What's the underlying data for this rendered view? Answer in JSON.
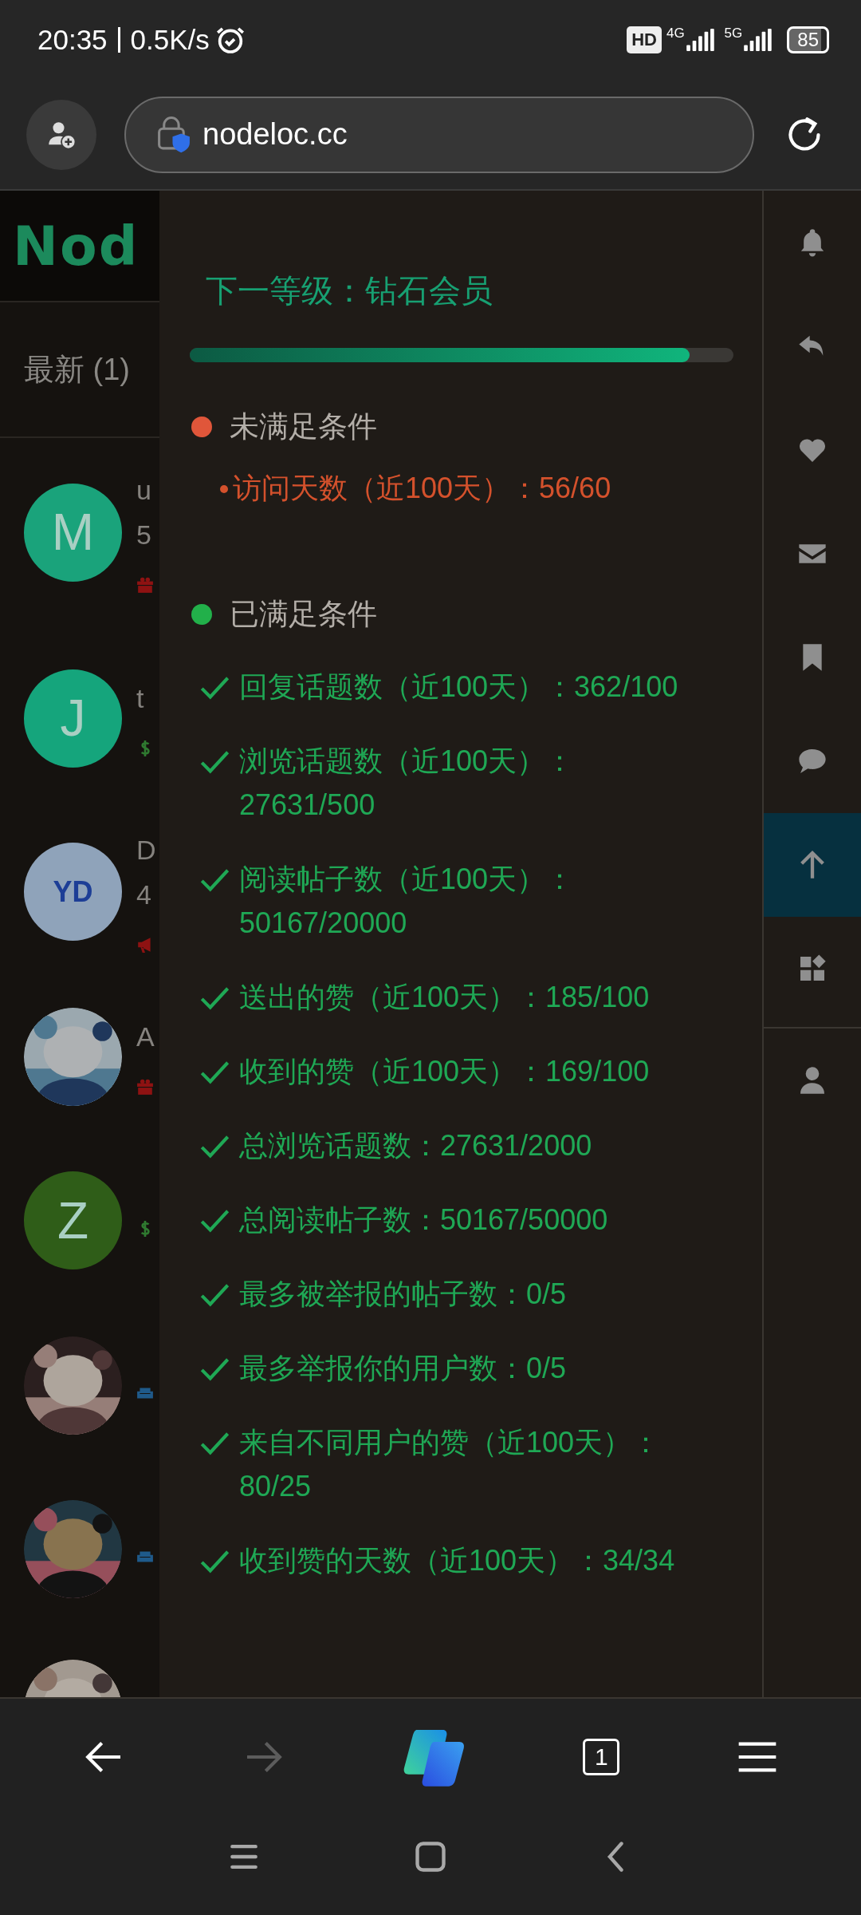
{
  "status_bar": {
    "time": "20:35",
    "speed": "0.5K/s",
    "hd": "HD",
    "network_1": "4G",
    "network_2": "5G",
    "battery": "85"
  },
  "address_bar": {
    "url": "nodeloc.cc"
  },
  "background_page": {
    "logo": "Nod",
    "tab": "最新 (1)",
    "topics": [
      {
        "avatar": {
          "kind": "letter",
          "text": "M",
          "color": "#1aa37b"
        },
        "lines": [
          "u",
          "5"
        ],
        "tag": {
          "kind": "gift"
        }
      },
      {
        "avatar": {
          "kind": "letter",
          "text": "J",
          "color": "#15a57c"
        },
        "lines": [
          "t"
        ],
        "tag": {
          "kind": "dollar"
        }
      },
      {
        "avatar": {
          "kind": "letter",
          "text": "YD",
          "color": "#8fa3ba"
        },
        "lines": [
          "D",
          "4"
        ],
        "tag": {
          "kind": "megaphone"
        }
      },
      {
        "avatar": {
          "kind": "picture"
        },
        "lines": [
          "A"
        ],
        "tag": {
          "kind": "gift"
        }
      },
      {
        "avatar": {
          "kind": "letter",
          "text": "Z",
          "color": "#2f5d18"
        },
        "tag": {
          "kind": "dollar"
        }
      },
      {
        "avatar": {
          "kind": "picture"
        },
        "tag": {
          "kind": "sofa"
        }
      },
      {
        "avatar": {
          "kind": "picture"
        },
        "tag": {
          "kind": "sofa"
        }
      },
      {
        "avatar": {
          "kind": "picture"
        }
      }
    ]
  },
  "panel": {
    "title": "下一等级：钻石会员",
    "progress": {
      "level": 0.92
    },
    "unmet": {
      "heading": "未满足条件",
      "items": [
        "访问天数（近100天）：56/60"
      ]
    },
    "met": {
      "heading": "已满足条件",
      "items": [
        "回复话题数（近100天）：362/100",
        "浏览话题数（近100天）：27631/500",
        "阅读帖子数（近100天）：50167/20000",
        "送出的赞（近100天）：185/100",
        "收到的赞（近100天）：169/100",
        "总浏览话题数：27631/2000",
        "总阅读帖子数：50167/50000",
        "最多被举报的帖子数：0/5",
        "最多举报你的用户数：0/5",
        "来自不同用户的赞（近100天）：80/25",
        "收到赞的天数（近100天）：34/34"
      ]
    }
  },
  "sidebar": [
    {
      "kind": "bell",
      "selected": false
    },
    {
      "kind": "reply",
      "selected": false
    },
    {
      "kind": "heart",
      "selected": false
    },
    {
      "kind": "envelope",
      "selected": false
    },
    {
      "kind": "bookmark",
      "selected": false
    },
    {
      "kind": "chat",
      "selected": false
    },
    {
      "kind": "arrow-up",
      "selected": true
    },
    {
      "kind": "widgets",
      "selected": false
    },
    {
      "kind": "user",
      "selected": false
    }
  ],
  "bottom_bar": {
    "forward": {
      "disabled": true
    },
    "tab_count": "1"
  }
}
